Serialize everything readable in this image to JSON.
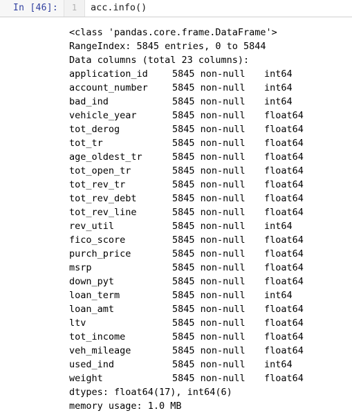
{
  "input_cell": {
    "prompt": "In [46]:",
    "line_number": "1",
    "code": "acc.info()"
  },
  "output": {
    "class_line": "<class 'pandas.core.frame.DataFrame'>",
    "range_index_line": "RangeIndex: 5845 entries, 0 to 5844",
    "data_columns_line": "Data columns (total 23 columns):",
    "columns": [
      {
        "name": "application_id",
        "count": "5845 non-null",
        "dtype": "int64"
      },
      {
        "name": "account_number",
        "count": "5845 non-null",
        "dtype": "int64"
      },
      {
        "name": "bad_ind",
        "count": "5845 non-null",
        "dtype": "int64"
      },
      {
        "name": "vehicle_year",
        "count": "5845 non-null",
        "dtype": "float64"
      },
      {
        "name": "tot_derog",
        "count": "5845 non-null",
        "dtype": "float64"
      },
      {
        "name": "tot_tr",
        "count": "5845 non-null",
        "dtype": "float64"
      },
      {
        "name": "age_oldest_tr",
        "count": "5845 non-null",
        "dtype": "float64"
      },
      {
        "name": "tot_open_tr",
        "count": "5845 non-null",
        "dtype": "float64"
      },
      {
        "name": "tot_rev_tr",
        "count": "5845 non-null",
        "dtype": "float64"
      },
      {
        "name": "tot_rev_debt",
        "count": "5845 non-null",
        "dtype": "float64"
      },
      {
        "name": "tot_rev_line",
        "count": "5845 non-null",
        "dtype": "float64"
      },
      {
        "name": "rev_util",
        "count": "5845 non-null",
        "dtype": "int64"
      },
      {
        "name": "fico_score",
        "count": "5845 non-null",
        "dtype": "float64"
      },
      {
        "name": "purch_price",
        "count": "5845 non-null",
        "dtype": "float64"
      },
      {
        "name": "msrp",
        "count": "5845 non-null",
        "dtype": "float64"
      },
      {
        "name": "down_pyt",
        "count": "5845 non-null",
        "dtype": "float64"
      },
      {
        "name": "loan_term",
        "count": "5845 non-null",
        "dtype": "int64"
      },
      {
        "name": "loan_amt",
        "count": "5845 non-null",
        "dtype": "float64"
      },
      {
        "name": "ltv",
        "count": "5845 non-null",
        "dtype": "float64"
      },
      {
        "name": "tot_income",
        "count": "5845 non-null",
        "dtype": "float64"
      },
      {
        "name": "veh_mileage",
        "count": "5845 non-null",
        "dtype": "float64"
      },
      {
        "name": "used_ind",
        "count": "5845 non-null",
        "dtype": "int64"
      },
      {
        "name": "weight",
        "count": "5845 non-null",
        "dtype": "float64"
      }
    ],
    "dtypes_line": "dtypes: float64(17), int64(6)",
    "memory_usage_line": "memory usage: 1.0 MB"
  },
  "colors": {
    "prompt_color": "#303F9F",
    "cell_background": "#F7F7F7",
    "code_background": "#FFFFFF",
    "gutter_background": "#F2F2F2",
    "text_color": "#000000"
  }
}
